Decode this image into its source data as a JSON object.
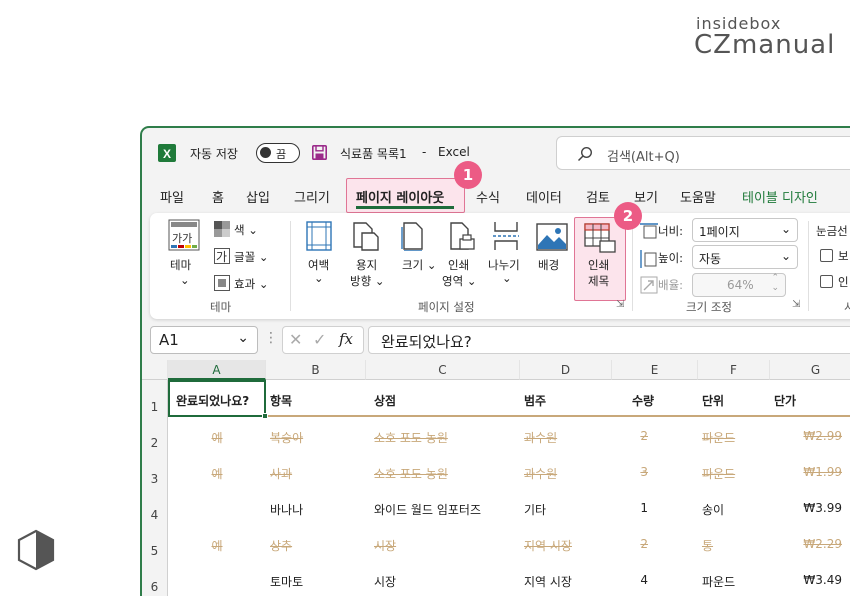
{
  "watermark": {
    "line1": "insidebox",
    "line2": "CZmanual"
  },
  "titlebar": {
    "autosave_label": "자동 저장",
    "autosave_state": "끔",
    "doc_name": "식료품 목록1",
    "separator": "-",
    "app_name": "Excel",
    "search_placeholder": "검색(Alt+Q)"
  },
  "menu": {
    "items": [
      "파일",
      "홈",
      "삽입",
      "그리기",
      "페이지 레이아웃",
      "수식",
      "데이터",
      "검토",
      "보기",
      "도움말",
      "테이블 디자인"
    ],
    "active_index": 4,
    "table_design_color": "#1f7a3a"
  },
  "badges": {
    "b1": "1",
    "b2": "2",
    "color": "#ec5b85"
  },
  "ribbon": {
    "theme": {
      "theme_label": "테마",
      "colors_label": "색",
      "fonts_label": "글꼴",
      "effects_label": "효과",
      "group_label": "테마"
    },
    "page_setup": {
      "margins": "여백",
      "orientation_line1": "용지",
      "orientation_line2": "방향",
      "size": "크기",
      "print_area_line1": "인쇄",
      "print_area_line2": "영역",
      "breaks": "나누기",
      "background": "배경",
      "print_titles_line1": "인쇄",
      "print_titles_line2": "제목",
      "group_label": "페이지 설정"
    },
    "scale": {
      "width_label": "너비:",
      "width_value": "1페이지",
      "height_label": "높이:",
      "height_value": "자동",
      "scale_label": "배율:",
      "scale_value": "64%",
      "group_label": "크기 조정"
    },
    "gridlines": {
      "title": "눈금선",
      "view_label": "보",
      "print_label": "인",
      "group_label": "시"
    }
  },
  "formula_bar": {
    "name_box": "A1",
    "fx": "fx",
    "formula": "완료되었나요?"
  },
  "sheet": {
    "columns": [
      "A",
      "B",
      "C",
      "D",
      "E",
      "F",
      "G"
    ],
    "rows": [
      "1",
      "2",
      "3",
      "4",
      "5",
      "6"
    ],
    "header": [
      "완료되었나요?",
      "항목",
      "상점",
      "범주",
      "수량",
      "단위",
      "단가"
    ],
    "data": [
      {
        "done": true,
        "cells": [
          "예",
          "복숭아",
          "소호 포도 농원",
          "과수원",
          "2",
          "파운드",
          "₩2.99"
        ]
      },
      {
        "done": true,
        "cells": [
          "예",
          "사과",
          "소호 포도 농원",
          "과수원",
          "3",
          "파운드",
          "₩1.99"
        ]
      },
      {
        "done": false,
        "cells": [
          "",
          "바나나",
          "와이드 월드 임포터즈",
          "기타",
          "1",
          "송이",
          "₩3.99"
        ]
      },
      {
        "done": true,
        "cells": [
          "예",
          "상추",
          "시장",
          "지역 시장",
          "2",
          "통",
          "₩2.29"
        ]
      },
      {
        "done": false,
        "cells": [
          "",
          "토마토",
          "시장",
          "지역 시장",
          "4",
          "파운드",
          "₩3.49"
        ]
      }
    ],
    "strike_color": "#c8a87a"
  }
}
